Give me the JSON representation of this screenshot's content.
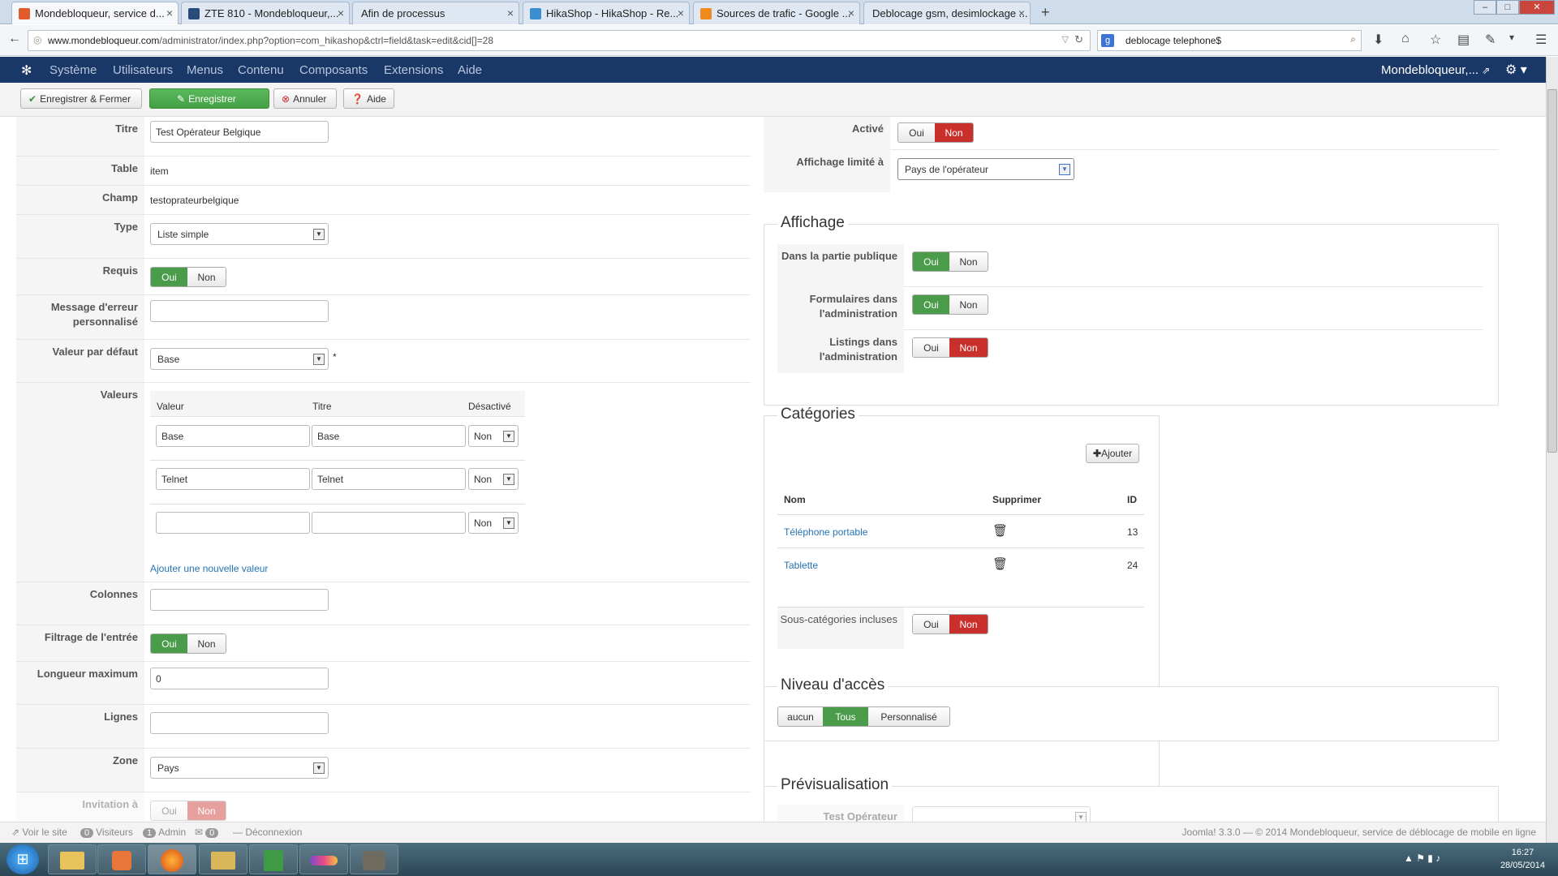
{
  "browser": {
    "tabs": [
      {
        "label": "Mondebloqueur, service d...",
        "active": true
      },
      {
        "label": "ZTE 810 - Mondebloqueur,..."
      },
      {
        "label": "Afin de processus"
      },
      {
        "label": "HikaShop - HikaShop - Re..."
      },
      {
        "label": "Sources de trafic - Google ..."
      },
      {
        "label": "Deblocage gsm, desimlockage ..."
      }
    ],
    "url_domain": "www.mondebloqueur.com",
    "url_path": "/administrator/index.php?option=com_hikashop&ctrl=field&task=edit&cid[]=28",
    "search": "deblocage telephone$"
  },
  "nav": {
    "items": [
      "Système",
      "Utilisateurs",
      "Menus",
      "Contenu",
      "Composants",
      "Extensions",
      "Aide"
    ],
    "user": "Mondebloqueur,...",
    "gear": "⚙ ▾"
  },
  "toolbar": {
    "save_close": "Enregistrer & Fermer",
    "save": "Enregistrer",
    "cancel": "Annuler",
    "help": "Aide"
  },
  "form": {
    "titre_label": "Titre",
    "titre_value": "Test Opérateur Belgique",
    "table_label": "Table",
    "table_value": "item",
    "champ_label": "Champ",
    "champ_value": "testoprateurbelgique",
    "type_label": "Type",
    "type_value": "Liste simple",
    "requis_label": "Requis",
    "message_label": "Message d'erreur personnalisé",
    "defaut_label": "Valeur par défaut",
    "defaut_value": "Base",
    "defaut_star": "*",
    "valeurs_label": "Valeurs",
    "valeurs_headers": [
      "Valeur",
      "Titre",
      "Désactivé"
    ],
    "valeurs_rows": [
      {
        "valeur": "Base",
        "titre": "Base",
        "desactive": "Non"
      },
      {
        "valeur": "Telnet",
        "titre": "Telnet",
        "desactive": "Non"
      },
      {
        "valeur": "",
        "titre": "",
        "desactive": "Non"
      }
    ],
    "add_value": "Ajouter une nouvelle valeur",
    "colonnes_label": "Colonnes",
    "filtrage_label": "Filtrage de l'entrée",
    "longueur_label": "Longueur maximum",
    "longueur_value": "0",
    "lignes_label": "Lignes",
    "zone_label": "Zone",
    "zone_value": "Pays",
    "invitation_label": "Invitation à"
  },
  "toggles": {
    "oui": "Oui",
    "non": "Non"
  },
  "right": {
    "active_label": "Activé",
    "affichage_limite_label": "Affichage limité à",
    "affichage_limite_value": "Pays de l'opérateur",
    "affichage_legend": "Affichage",
    "dans_partie_label": "Dans la partie publique",
    "formulaires_label": "Formulaires dans l'administration",
    "listings_label": "Listings dans l'administration",
    "categories_legend": "Catégories",
    "ajouter": "Ajouter",
    "cat_headers": [
      "Nom",
      "Supprimer",
      "ID"
    ],
    "cat_rows": [
      {
        "nom": "Téléphone portable",
        "id": "13"
      },
      {
        "nom": "Tablette",
        "id": "24"
      }
    ],
    "sous_cat_label": "Sous-catégories incluses",
    "niveau_legend": "Niveau d'accès",
    "niveau_options": [
      "aucun",
      "Tous",
      "Personnalisé"
    ],
    "preview_legend": "Prévisualisation",
    "preview_field": "Test Opérateur"
  },
  "footer": {
    "view_site": "Voir le site",
    "visitors_count": "0",
    "visitors": "Visiteurs",
    "admin_count": "1",
    "admin": "Admin",
    "msg_count": "0",
    "logout": "Déconnexion",
    "copyright": "Joomla! 3.3.0 — © 2014 Mondebloqueur, service de déblocage de mobile en ligne"
  },
  "taskbar": {
    "time": "16:27",
    "date": "28/05/2014"
  },
  "colors": {
    "green": "#4a9b4a",
    "red": "#c9302c",
    "navy": "#1a3867",
    "link": "#2573b5"
  }
}
